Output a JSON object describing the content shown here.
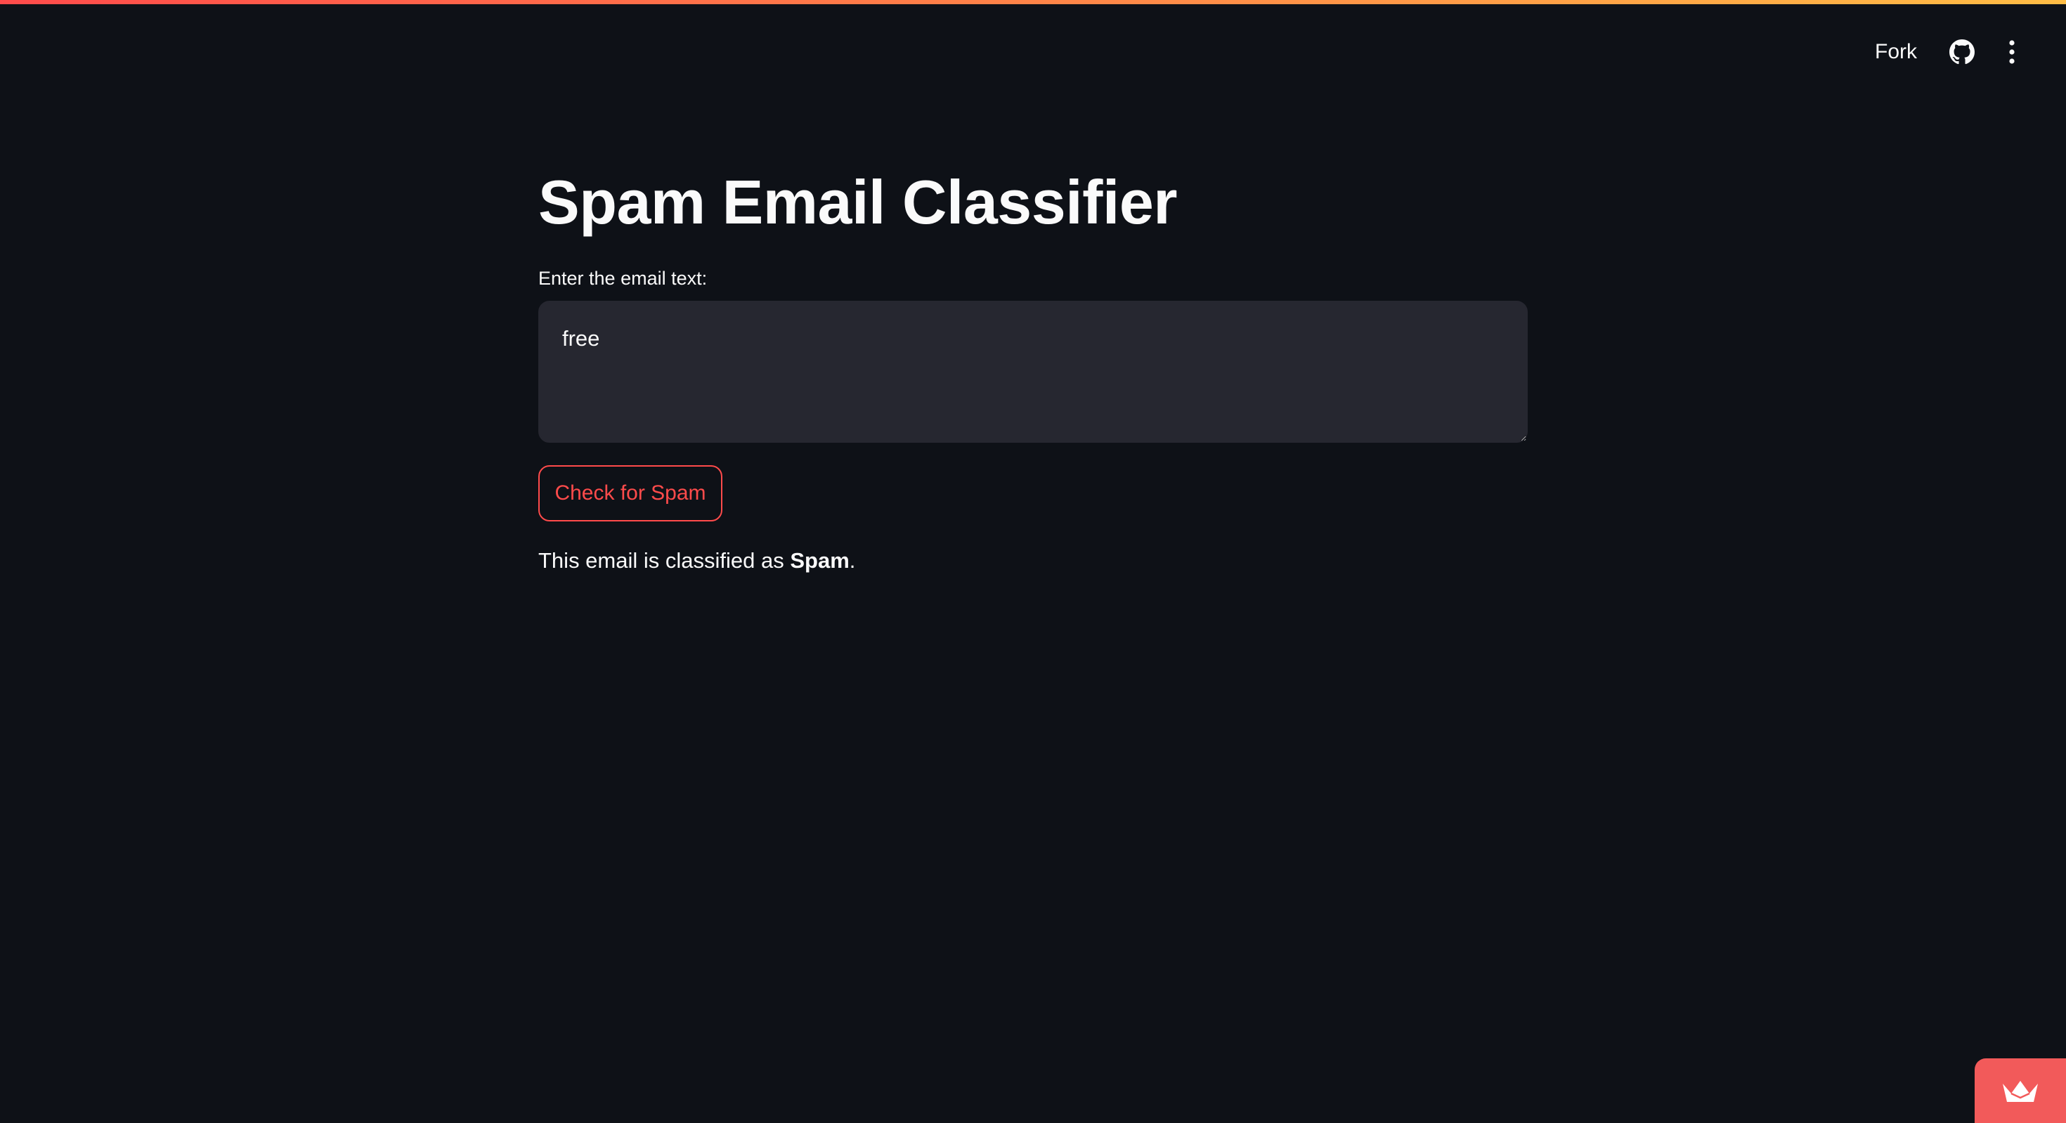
{
  "header": {
    "fork_label": "Fork",
    "github_icon": "github-icon",
    "menu_icon": "more-vertical-icon"
  },
  "main": {
    "title": "Spam Email Classifier",
    "input_label": "Enter the email text:",
    "input_value": "free",
    "button_label": "Check for Spam",
    "result_prefix": "This email is classified as ",
    "result_value": "Spam",
    "result_suffix": "."
  },
  "badge": {
    "icon": "streamlit-crown-icon"
  },
  "colors": {
    "background": "#0e1117",
    "accent": "#ff4b4b",
    "textarea_bg": "#262730",
    "badge_bg": "#f25a5a"
  }
}
